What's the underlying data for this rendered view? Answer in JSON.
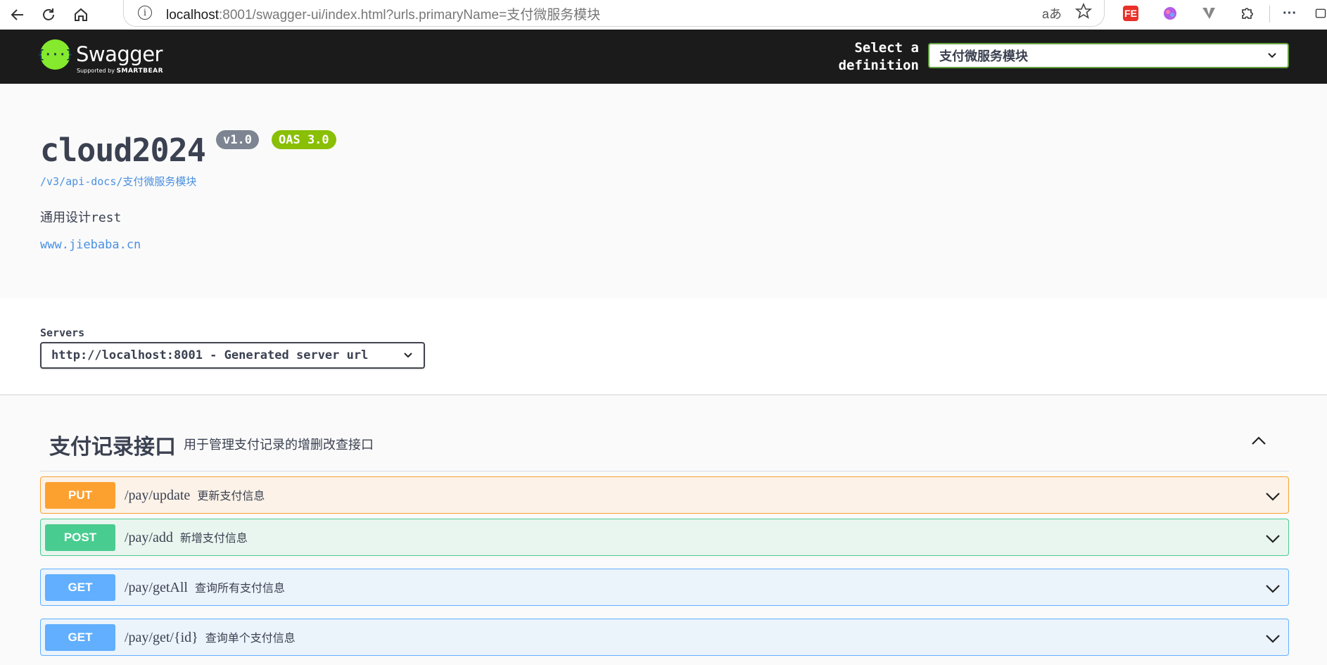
{
  "browser": {
    "url_host": "localhost",
    "url_rest": ":8001/swagger-ui/index.html?urls.primaryName=支付微服务模块",
    "info_glyph": "i",
    "read_aloud": "aあ",
    "more": "···"
  },
  "topbar": {
    "logo_text": "Swagger",
    "logo_glyph": "{···}",
    "logo_sub_prefix": "Supported by ",
    "logo_sub_brand": "SMARTBEAR",
    "select_label": "Select a definition",
    "selected_definition": "支付微服务模块"
  },
  "info": {
    "title": "cloud2024",
    "version": "v1.0",
    "oas": "OAS 3.0",
    "doc_link": "/v3/api-docs/支付微服务模块",
    "description": "通用设计rest",
    "site_link": "www.jiebaba.cn"
  },
  "servers": {
    "label": "Servers",
    "selected": "http://localhost:8001 - Generated server url"
  },
  "tag": {
    "name": "支付记录接口",
    "description": "用于管理支付记录的增删改查接口"
  },
  "operations": [
    {
      "method": "PUT",
      "path": "/pay/update",
      "summary": "更新支付信息"
    },
    {
      "method": "POST",
      "path": "/pay/add",
      "summary": "新增支付信息"
    },
    {
      "method": "GET",
      "path": "/pay/getAll",
      "summary": "查询所有支付信息"
    },
    {
      "method": "GET",
      "path": "/pay/get/{id}",
      "summary": "查询单个支付信息"
    }
  ],
  "colors": {
    "put": "#fca130",
    "post": "#49cc90",
    "get": "#61affe",
    "topbar": "#1b1b1b",
    "swagger_green": "#85ea2d"
  }
}
